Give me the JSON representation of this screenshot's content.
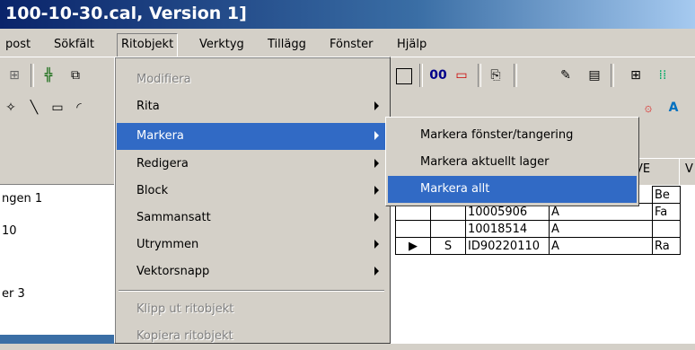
{
  "window": {
    "title": "100-10-30.cal, Version 1]"
  },
  "menubar": {
    "items": [
      {
        "label": "post"
      },
      {
        "label": "Sökfält"
      },
      {
        "label": "Ritobjekt"
      },
      {
        "label": "Verktyg"
      },
      {
        "label": "Tillägg"
      },
      {
        "label": "Fönster"
      },
      {
        "label": "Hjälp"
      }
    ]
  },
  "ritobjekt_menu": {
    "items": [
      {
        "label": "Modifiera",
        "enabled": false
      },
      {
        "label": "Rita",
        "submenu": true
      },
      {
        "label": "Markera",
        "submenu": true,
        "highlighted": true
      },
      {
        "label": "Redigera",
        "submenu": true
      },
      {
        "label": "Block",
        "submenu": true
      },
      {
        "label": "Sammansatt",
        "submenu": true
      },
      {
        "label": "Utrymmen",
        "submenu": true
      },
      {
        "label": "Vektorsnapp",
        "submenu": true
      },
      {
        "label": "Klipp ut ritobjekt",
        "enabled": false
      },
      {
        "label": "Kopiera ritobjekt",
        "enabled": false
      }
    ]
  },
  "markera_submenu": {
    "items": [
      {
        "label": "Markera fönster/tangering"
      },
      {
        "label": "Markera aktuellt lager"
      },
      {
        "label": "Markera allt",
        "highlighted": true
      }
    ]
  },
  "left_panel": {
    "tree": [
      "ngen 1",
      "10",
      "er 3"
    ]
  },
  "tabs": [
    {
      "label": "VE"
    },
    {
      "label": "V"
    }
  ],
  "grid": {
    "header_partial": "Be",
    "rows": [
      {
        "marker": "",
        "col1": "",
        "id": "10005906",
        "code": "A",
        "extra": "Fa"
      },
      {
        "marker": "",
        "col1": "",
        "id": "10018514",
        "code": "A",
        "extra": ""
      },
      {
        "marker": "▶",
        "col1": "S",
        "id": "ID90220110",
        "code": "A",
        "extra": "Ra"
      }
    ]
  },
  "toolbar": {
    "zoom_text": "00"
  },
  "colors": {
    "highlight": "#316ac5",
    "face": "#d4d0c8",
    "title_start": "#0a246a"
  }
}
